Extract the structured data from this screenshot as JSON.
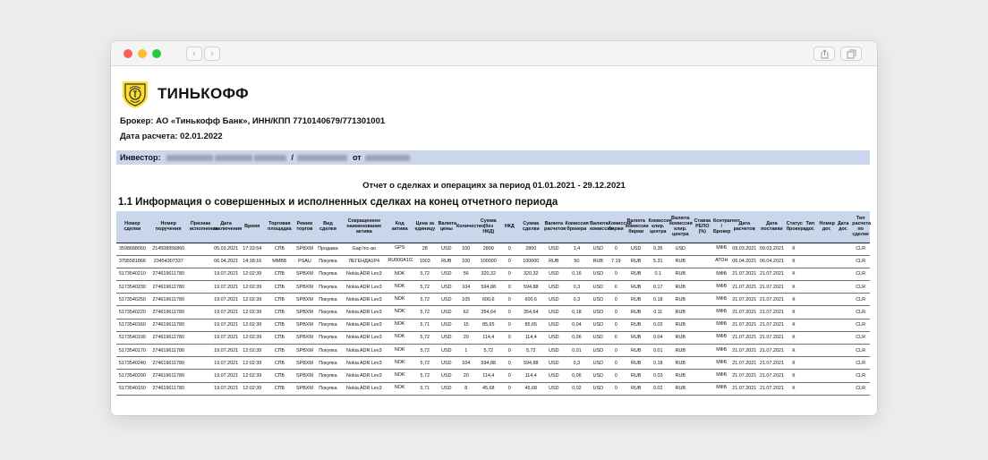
{
  "document": {
    "logo_text": "ТИНЬКОФФ",
    "broker_line": "Брокер: АО «Тинькофф Банк», ИНН/КПП 7710140679/771301001",
    "settlement_date_line": "Дата расчета: 02.01.2022",
    "investor_label": "Инвестор:",
    "investor_from": "от",
    "investor_slash": "/",
    "report_title": "Отчет о сделках и операциях за период 01.01.2021 - 29.12.2021",
    "section_title": "1.1 Информация о совершенных и исполненных сделках на конец отчетного периода"
  },
  "table": {
    "headers": [
      "Номер сделки",
      "Номер поручения",
      "Признак исполнения",
      "Дата заключения",
      "Время",
      "Торговая площадка",
      "Режим торгов",
      "Вид сделки",
      "Сокращенное наименование актива",
      "Код актива",
      "Цена за единицу",
      "Валюта цены",
      "Количество",
      "Сумма (без НКД)",
      "НКД",
      "Сумма сделки",
      "Валюта расчетов",
      "Комиссия брокера",
      "Валюта комиссии",
      "Комиссия биржи",
      "Валюта комиссии биржи",
      "Комиссия клир. центра",
      "Валюта комиссии клир. центра",
      "Ставка РЕПО (%)",
      "Контрагент / Брокер",
      "Дата расчетов",
      "Дата поставки",
      "Статус брокера",
      "Тип дог.",
      "Номер дог.",
      "Дата дог.",
      "Тип расчета по сделке"
    ],
    "rows": [
      [
        "3598688060",
        "214508956860",
        "",
        "05.03.2021",
        "17:33:54",
        "СПБ",
        "SPBXM",
        "Продажа",
        "Gap Inc-ao",
        "GPS",
        "28",
        "USD",
        "100",
        "2800",
        "0",
        "2800",
        "USD",
        "1,4",
        "USD",
        "0",
        "USD",
        "0.35",
        "USD",
        "",
        "МФБ",
        "09.03.2021",
        "09.03.2021",
        "К",
        "",
        "",
        "",
        "CLR"
      ],
      [
        "3795581866",
        "23454307337",
        "",
        "06.04.2021",
        "14:18:16",
        "ММВБ",
        "PSAU",
        "Покупка",
        "ЛЕГЕНДА1Р4",
        "RU000A102Y66",
        "1003",
        "RUB",
        "100",
        "100000",
        "0",
        "100000",
        "RUB",
        "50",
        "RUB",
        "7.19",
        "RUB",
        "5.31",
        "RUB",
        "",
        "АТОН",
        "06.04.2021",
        "06.04.2021",
        "К",
        "",
        "",
        "",
        "CLR"
      ],
      [
        "5173540210",
        "274619611780",
        "",
        "19.07.2021",
        "12:02:39",
        "СПБ",
        "SPBXM",
        "Покупка",
        "Nokia ADR Lev3",
        "NOK",
        "5,72",
        "USD",
        "56",
        "320,32",
        "0",
        "320,32",
        "USD",
        "0,16",
        "USD",
        "0",
        "RUB",
        "0.1",
        "RUB",
        "",
        "МФБ",
        "21.07.2021",
        "21.07.2021",
        "К",
        "",
        "",
        "",
        "CLR"
      ],
      [
        "5173540230",
        "274619611780",
        "",
        "19.07.2021",
        "12:02:39",
        "СПБ",
        "SPBXM",
        "Покупка",
        "Nokia ADR Lev3",
        "NOK",
        "5,72",
        "USD",
        "104",
        "594,88",
        "0",
        "594,88",
        "USD",
        "0,3",
        "USD",
        "0",
        "RUB",
        "0.17",
        "RUB",
        "",
        "МФБ",
        "21.07.2021",
        "21.07.2021",
        "К",
        "",
        "",
        "",
        "CLR"
      ],
      [
        "5173540250",
        "274619611780",
        "",
        "19.07.2021",
        "12:02:39",
        "СПБ",
        "SPBXM",
        "Покупка",
        "Nokia ADR Lev3",
        "NOK",
        "5,72",
        "USD",
        "105",
        "600,6",
        "0",
        "600,6",
        "USD",
        "0,3",
        "USD",
        "0",
        "RUB",
        "0.18",
        "RUB",
        "",
        "МФБ",
        "21.07.2021",
        "21.07.2021",
        "К",
        "",
        "",
        "",
        "CLR"
      ],
      [
        "5173540220",
        "274619611780",
        "",
        "19.07.2021",
        "12:02:39",
        "СПБ",
        "SPBXM",
        "Покупка",
        "Nokia ADR Lev3",
        "NOK",
        "5,72",
        "USD",
        "62",
        "354,64",
        "0",
        "354,64",
        "USD",
        "0,18",
        "USD",
        "0",
        "RUB",
        "0.11",
        "RUB",
        "",
        "МФБ",
        "21.07.2021",
        "21.07.2021",
        "К",
        "",
        "",
        "",
        "CLR"
      ],
      [
        "5173540160",
        "274619611780",
        "",
        "19.07.2021",
        "12:02:39",
        "СПБ",
        "SPBXM",
        "Покупка",
        "Nokia ADR Lev3",
        "NOK",
        "5,71",
        "USD",
        "15",
        "85,65",
        "0",
        "85,65",
        "USD",
        "0,04",
        "USD",
        "0",
        "RUB",
        "0.02",
        "RUB",
        "",
        "МФБ",
        "21.07.2021",
        "21.07.2021",
        "К",
        "",
        "",
        "",
        "CLR"
      ],
      [
        "5173540190",
        "274619611780",
        "",
        "19.07.2021",
        "12:02:39",
        "СПБ",
        "SPBXM",
        "Покупка",
        "Nokia ADR Lev3",
        "NOK",
        "5,72",
        "USD",
        "20",
        "114,4",
        "0",
        "114,4",
        "USD",
        "0,06",
        "USD",
        "0",
        "RUB",
        "0.04",
        "RUB",
        "",
        "МФБ",
        "21.07.2021",
        "21.07.2021",
        "К",
        "",
        "",
        "",
        "CLR"
      ],
      [
        "5173540170",
        "274619611780",
        "",
        "19.07.2021",
        "12:02:39",
        "СПБ",
        "SPBXM",
        "Покупка",
        "Nokia ADR Lev3",
        "NOK",
        "5,72",
        "USD",
        "1",
        "5,72",
        "0",
        "5,72",
        "USD",
        "0,01",
        "USD",
        "0",
        "RUB",
        "0.01",
        "RUB",
        "",
        "МФБ",
        "21.07.2021",
        "21.07.2021",
        "К",
        "",
        "",
        "",
        "CLR"
      ],
      [
        "5173540240",
        "274619611780",
        "",
        "19.07.2021",
        "12:02:39",
        "СПБ",
        "SPBXM",
        "Покупка",
        "Nokia ADR Lev3",
        "NOK",
        "5,72",
        "USD",
        "104",
        "594,88",
        "0",
        "594,88",
        "USD",
        "0,3",
        "USD",
        "0",
        "RUB",
        "0.18",
        "RUB",
        "",
        "МФБ",
        "21.07.2021",
        "21.07.2021",
        "К",
        "",
        "",
        "",
        "CLR"
      ],
      [
        "5173540200",
        "274619611780",
        "",
        "19.07.2021",
        "12:02:39",
        "СПБ",
        "SPBXM",
        "Покупка",
        "Nokia ADR Lev3",
        "NOK",
        "5,72",
        "USD",
        "20",
        "114,4",
        "0",
        "114,4",
        "USD",
        "0,06",
        "USD",
        "0",
        "RUB",
        "0.03",
        "RUB",
        "",
        "МФБ",
        "21.07.2021",
        "21.07.2021",
        "К",
        "",
        "",
        "",
        "CLR"
      ],
      [
        "5173540150",
        "274619611780",
        "",
        "19.07.2021",
        "12:02:39",
        "СПБ",
        "SPBXM",
        "Покупка",
        "Nokia ADR Lev3",
        "NOK",
        "5,71",
        "USD",
        "8",
        "45,68",
        "0",
        "45,68",
        "USD",
        "0,02",
        "USD",
        "0",
        "RUB",
        "0.02",
        "RUB",
        "",
        "МФБ",
        "21.07.2021",
        "21.07.2021",
        "К",
        "",
        "",
        "",
        "CLR"
      ]
    ]
  },
  "colors": {
    "header_bg": "#c9d6ec",
    "brand_yellow": "#ffdd2d"
  },
  "icons": {
    "share": "share-icon",
    "tabs": "tabs-icon",
    "back": "chevron-left-icon",
    "forward": "chevron-right-icon"
  }
}
